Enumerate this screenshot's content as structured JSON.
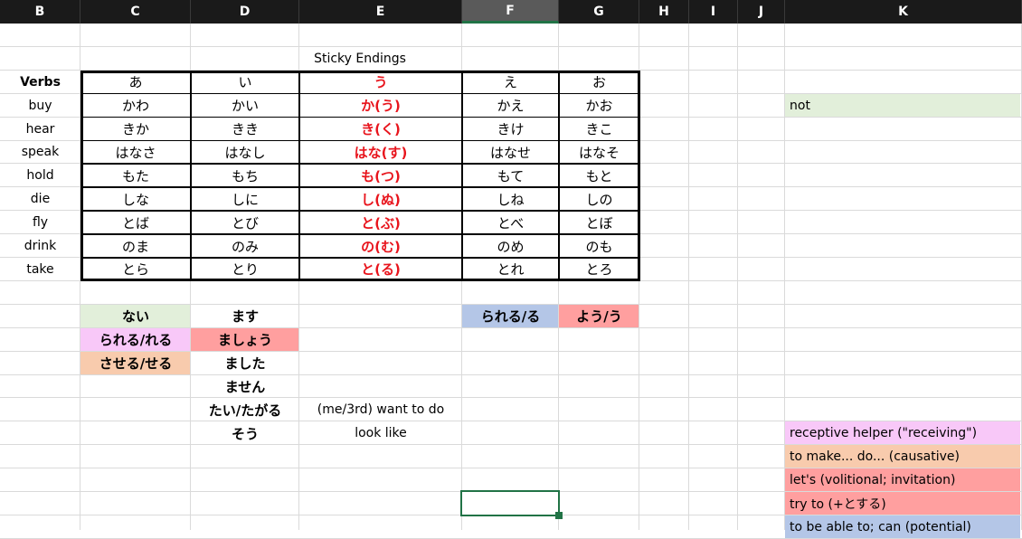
{
  "column_headers": [
    "B",
    "C",
    "D",
    "E",
    "F",
    "G",
    "H",
    "I",
    "J",
    "K"
  ],
  "selected_column": "F",
  "title": "Sticky Endings",
  "verbs_header": "Verbs",
  "verbs": [
    "buy",
    "hear",
    "speak",
    "hold",
    "die",
    "fly",
    "drink",
    "take"
  ],
  "kana_headers": [
    "あ",
    "い",
    "う",
    "え",
    "お"
  ],
  "table": [
    [
      "かわ",
      "かい",
      "か(う)",
      "かえ",
      "かお"
    ],
    [
      "きか",
      "きき",
      "き(く)",
      "きけ",
      "きこ"
    ],
    [
      "はなさ",
      "はなし",
      "はな(す)",
      "はなせ",
      "はなそ"
    ],
    [
      "もた",
      "もち",
      "も(つ)",
      "もて",
      "もと"
    ],
    [
      "しな",
      "しに",
      "し(ぬ)",
      "しね",
      "しの"
    ],
    [
      "とば",
      "とび",
      "と(ぶ)",
      "とべ",
      "とぼ"
    ],
    [
      "のま",
      "のみ",
      "の(む)",
      "のめ",
      "のも"
    ],
    [
      "とら",
      "とり",
      "と(る)",
      "とれ",
      "とろ"
    ]
  ],
  "endings": {
    "c1": "ない",
    "c2": "られる/れる",
    "c3": "させる/せる",
    "d1": "ます",
    "d2": "ましょう",
    "d3": "ました",
    "d4": "ません",
    "d5": "たい/たがる",
    "d6": "そう",
    "e5": "(me/3rd) want to do",
    "e6": "look like",
    "f1": "られる/る",
    "g1": "よう/う"
  },
  "legend": {
    "not": "not",
    "receptive": "receptive helper (\"receiving\")",
    "causative": "to make... do... (causative)",
    "volitional": "let's (volitional; invitation)",
    "try": "try to (+とする)",
    "potential": "to be able to; can (potential)"
  },
  "colors": {
    "green": "#e2efda",
    "pink": "#f8c8f8",
    "peach": "#f8cbad",
    "salmon": "#ff9f9f",
    "blue": "#b4c6e7",
    "red_text": "#e8141c",
    "selection": "#217346"
  }
}
